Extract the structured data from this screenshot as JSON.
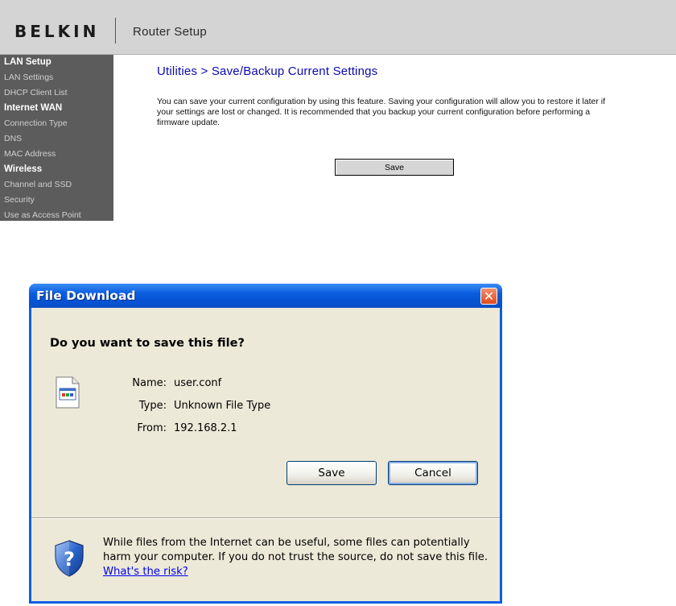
{
  "router": {
    "brand": "BELKIN",
    "app_title": "Router Setup",
    "sidebar": {
      "sections": [
        {
          "heading": "LAN Setup",
          "items": [
            "LAN Settings",
            "DHCP Client List"
          ]
        },
        {
          "heading": "Internet WAN",
          "items": [
            "Connection Type",
            "DNS",
            "MAC Address"
          ]
        },
        {
          "heading": "Wireless",
          "items": [
            "Channel and SSD",
            "Security",
            "Use as Access Point"
          ]
        }
      ]
    },
    "page_title": "Utilities > Save/Backup Current Settings",
    "description": "You can save your current configuration by using this feature. Saving your configuration will allow you to restore it later if your settings are lost or changed. It is recommended that you backup your current configuration before performing a firmware update.",
    "save_label": "Save"
  },
  "dialog": {
    "title": "File Download",
    "close_glyph": "✕",
    "question": "Do you want to save this file?",
    "name_label": "Name:",
    "name_value": "user.conf",
    "type_label": "Type:",
    "type_value": "Unknown File Type",
    "from_label": "From:",
    "from_value": "192.168.2.1",
    "save_label": "Save",
    "cancel_label": "Cancel",
    "warning_text": "While files from the Internet can be useful, some files can potentially harm your computer. If you do not trust the source, do not save this file.",
    "risk_link": "What's the risk?"
  },
  "icons": {
    "file": "file-icon",
    "shield": "shield-question-icon",
    "close": "close-icon"
  }
}
